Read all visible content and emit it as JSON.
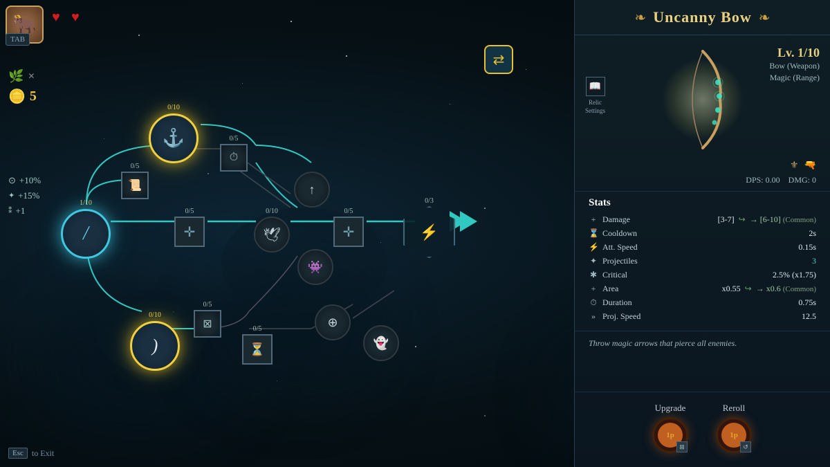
{
  "app": {
    "title": "Uncanny Bow",
    "esc_hint": "to Exit",
    "esc_key": "Esc"
  },
  "character": {
    "hearts": [
      "♥",
      "♥"
    ],
    "currency_icon": "🌿",
    "currency_x": "✕",
    "gold": "5",
    "tab_label": "TAB"
  },
  "left_stats": [
    {
      "icon": "⊙",
      "value": "+10%",
      "color": "#a0c8c0"
    },
    {
      "icon": "✦",
      "value": "+15%",
      "color": "#a0c8c0"
    },
    {
      "icon": "⁑",
      "value": "+1",
      "color": "#a0c8c0"
    }
  ],
  "skill_tree": {
    "nodes": [
      {
        "id": "top-large",
        "label": "0/10",
        "type": "large",
        "glow": "yellow",
        "icon": "⚓"
      },
      {
        "id": "top-medium-1",
        "label": "0/5",
        "type": "medium",
        "icon": "🕐"
      },
      {
        "id": "top-medium-2",
        "label": "0/5",
        "type": "medium",
        "icon": "𝌫"
      },
      {
        "id": "top-right-med",
        "label": "",
        "type": "medium",
        "icon": "↑"
      },
      {
        "id": "center-large",
        "label": "1/10",
        "type": "large",
        "glow": "blue",
        "icon": "/"
      },
      {
        "id": "center-cross",
        "label": "0/5",
        "type": "cross",
        "icon": "✛"
      },
      {
        "id": "center-bird",
        "label": "0/10",
        "type": "medium",
        "icon": "🕊"
      },
      {
        "id": "center-sword",
        "label": "0/5",
        "type": "cross",
        "icon": "✛"
      },
      {
        "id": "center-hex",
        "label": "0/3",
        "type": "hex",
        "icon": "⚡"
      },
      {
        "id": "bot-large",
        "label": "0/10",
        "type": "large",
        "glow": "yellow",
        "icon": ")"
      },
      {
        "id": "bot-cross",
        "label": "0/5",
        "type": "cross",
        "icon": "⊠"
      },
      {
        "id": "bot-med-1",
        "label": "0/5",
        "type": "medium",
        "icon": "⊕"
      },
      {
        "id": "top-blob",
        "label": "",
        "type": "medium",
        "icon": "👾"
      },
      {
        "id": "bot-blob",
        "label": "",
        "type": "medium",
        "icon": "👻"
      }
    ]
  },
  "weapon": {
    "title": "Uncanny Bow",
    "level": "Lv. 1/10",
    "type_line1": "Bow (Weapon)",
    "type_line2": "Magic (Range)",
    "dps_label": "DPS:",
    "dps_value": "0.00",
    "dmg_label": "DMG:",
    "dmg_value": "0",
    "relic_label": "Relic\nSettings",
    "ornament_left": "❧",
    "ornament_right": "❧"
  },
  "stats": {
    "title": "Stats",
    "rows": [
      {
        "icon": "+",
        "name": "Damage",
        "value": "[3-7]",
        "upgrade": "→ [6-10]",
        "tag": "(Common)"
      },
      {
        "icon": "⌛",
        "name": "Cooldown",
        "value": "2s",
        "upgrade": "",
        "tag": ""
      },
      {
        "icon": "⚡",
        "name": "Att. Speed",
        "value": "0.15s",
        "upgrade": "",
        "tag": ""
      },
      {
        "icon": "✦",
        "name": "Projectiles",
        "value": "3",
        "upgrade": "",
        "tag": "",
        "cyan": true
      },
      {
        "icon": "✱",
        "name": "Critical",
        "value": "2.5% (x1.75)",
        "upgrade": "",
        "tag": ""
      },
      {
        "icon": "+",
        "name": "Area",
        "value": "x0.55",
        "upgrade": "→ x0.6",
        "tag": "(Common)"
      },
      {
        "icon": "⏱",
        "name": "Duration",
        "value": "0.75s",
        "upgrade": "",
        "tag": ""
      },
      {
        "icon": "»",
        "name": "Proj. Speed",
        "value": "12.5",
        "upgrade": "",
        "tag": ""
      }
    ]
  },
  "description": "Throw magic arrows that pierce all enemies.",
  "buttons": {
    "upgrade_label": "Upgrade",
    "upgrade_cost": "1p",
    "reroll_label": "Reroll",
    "reroll_cost": "1p"
  }
}
